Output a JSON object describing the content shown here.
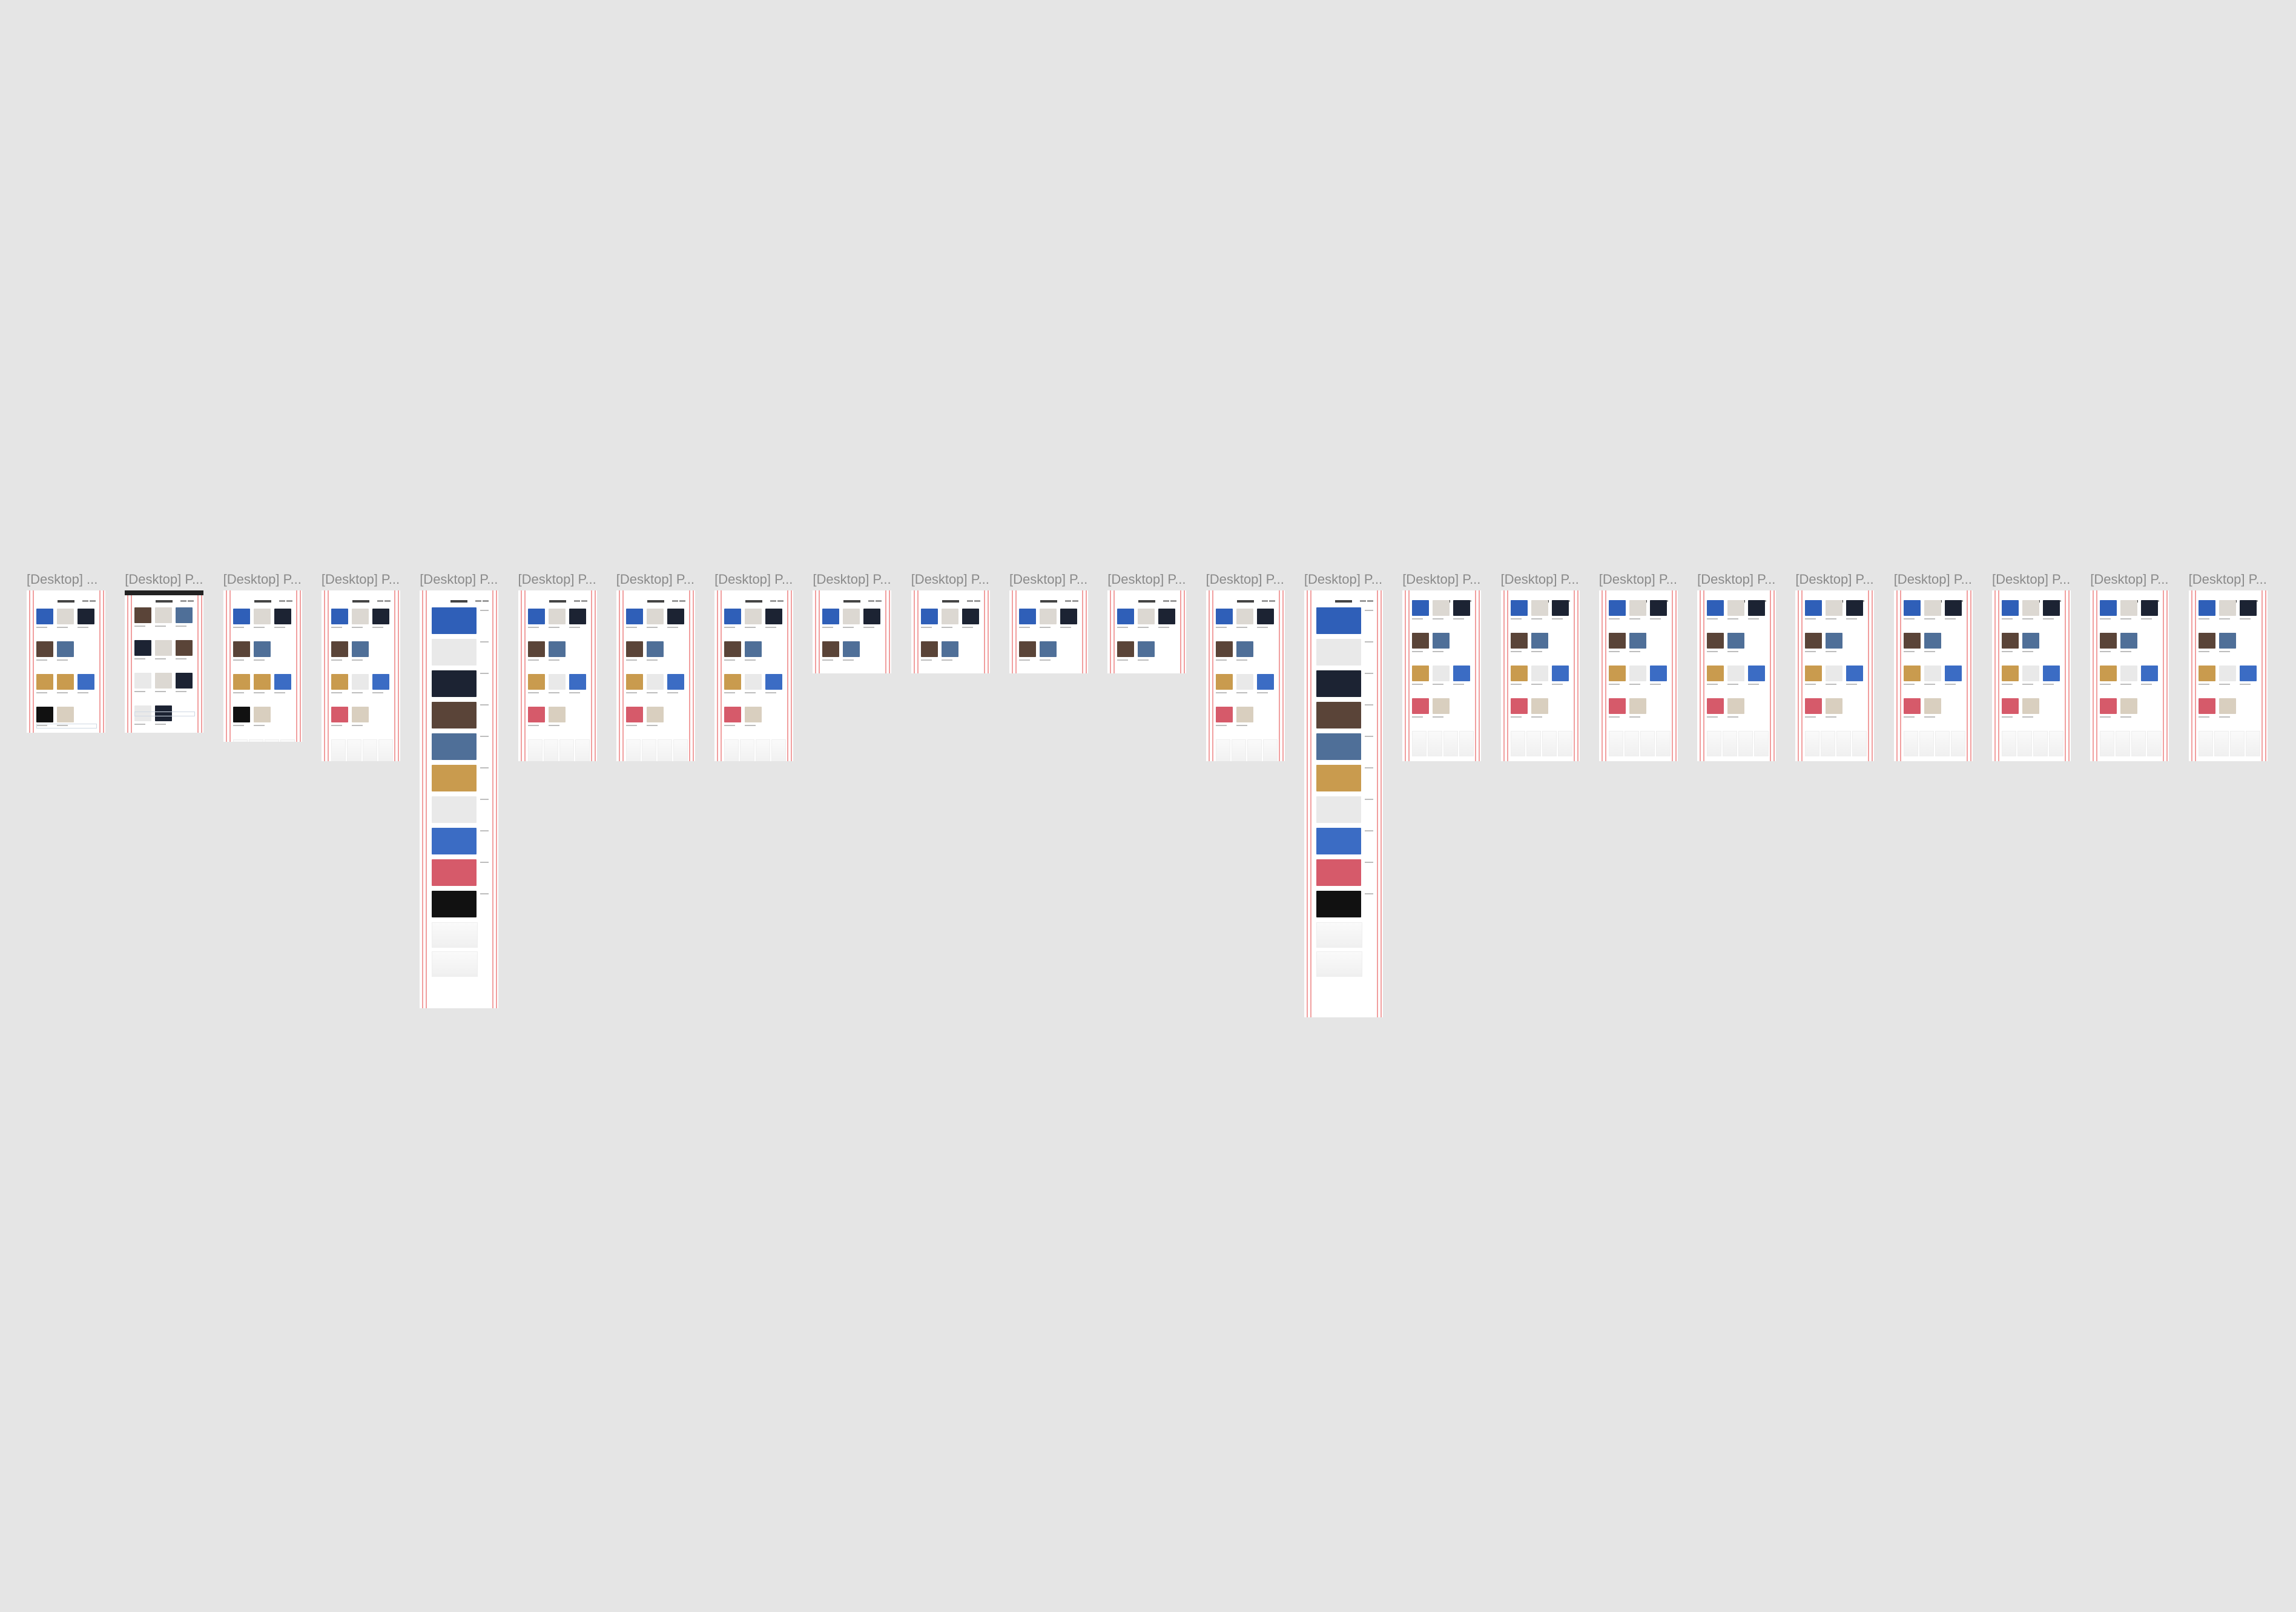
{
  "canvas": {
    "background": "#e5e5e5",
    "grid_color": "#e65050"
  },
  "frames": [
    {
      "title": "[Desktop] ...",
      "variant": "home"
    },
    {
      "title": "[Desktop] P...",
      "variant": "dark"
    },
    {
      "title": "[Desktop] P...",
      "variant": "grid-a"
    },
    {
      "title": "[Desktop] P...",
      "variant": "grid-b"
    },
    {
      "title": "[Desktop] P...",
      "variant": "column"
    },
    {
      "title": "[Desktop] P...",
      "variant": "grid-b"
    },
    {
      "title": "[Desktop] P...",
      "variant": "grid-b"
    },
    {
      "title": "[Desktop] P...",
      "variant": "grid-b"
    },
    {
      "title": "[Desktop] P...",
      "variant": "short"
    },
    {
      "title": "[Desktop] P...",
      "variant": "short"
    },
    {
      "title": "[Desktop] P...",
      "variant": "short"
    },
    {
      "title": "[Desktop] P...",
      "variant": "short"
    },
    {
      "title": "[Desktop] P...",
      "variant": "grid-c"
    },
    {
      "title": "[Desktop] P...",
      "variant": "column"
    },
    {
      "title": "[Desktop] P...",
      "variant": "grid-d"
    },
    {
      "title": "[Desktop] P...",
      "variant": "grid-d"
    },
    {
      "title": "[Desktop] P...",
      "variant": "grid-d"
    },
    {
      "title": "[Desktop] P...",
      "variant": "grid-d"
    },
    {
      "title": "[Desktop] P...",
      "variant": "grid-d"
    },
    {
      "title": "[Desktop] P...",
      "variant": "grid-d"
    },
    {
      "title": "[Desktop] P...",
      "variant": "grid-d"
    },
    {
      "title": "[Desktop] P...",
      "variant": "grid-d"
    },
    {
      "title": "[Desktop] P...",
      "variant": "grid-d"
    }
  ],
  "photo_palette": {
    "sky_blue": "#2f5fb8",
    "pale_grey": "#dcd8d2",
    "dark_night": "#1c2333",
    "brown_wall": "#5a4438",
    "blue_sphere": "#4f6f98",
    "ochre_window": "#c99b4e",
    "white_statue": "#e9e9e9",
    "blue_red": "#3b6cc4",
    "pink_wall": "#d65a6a",
    "beige_diagonal": "#d9cfbf",
    "black": "#111111"
  }
}
